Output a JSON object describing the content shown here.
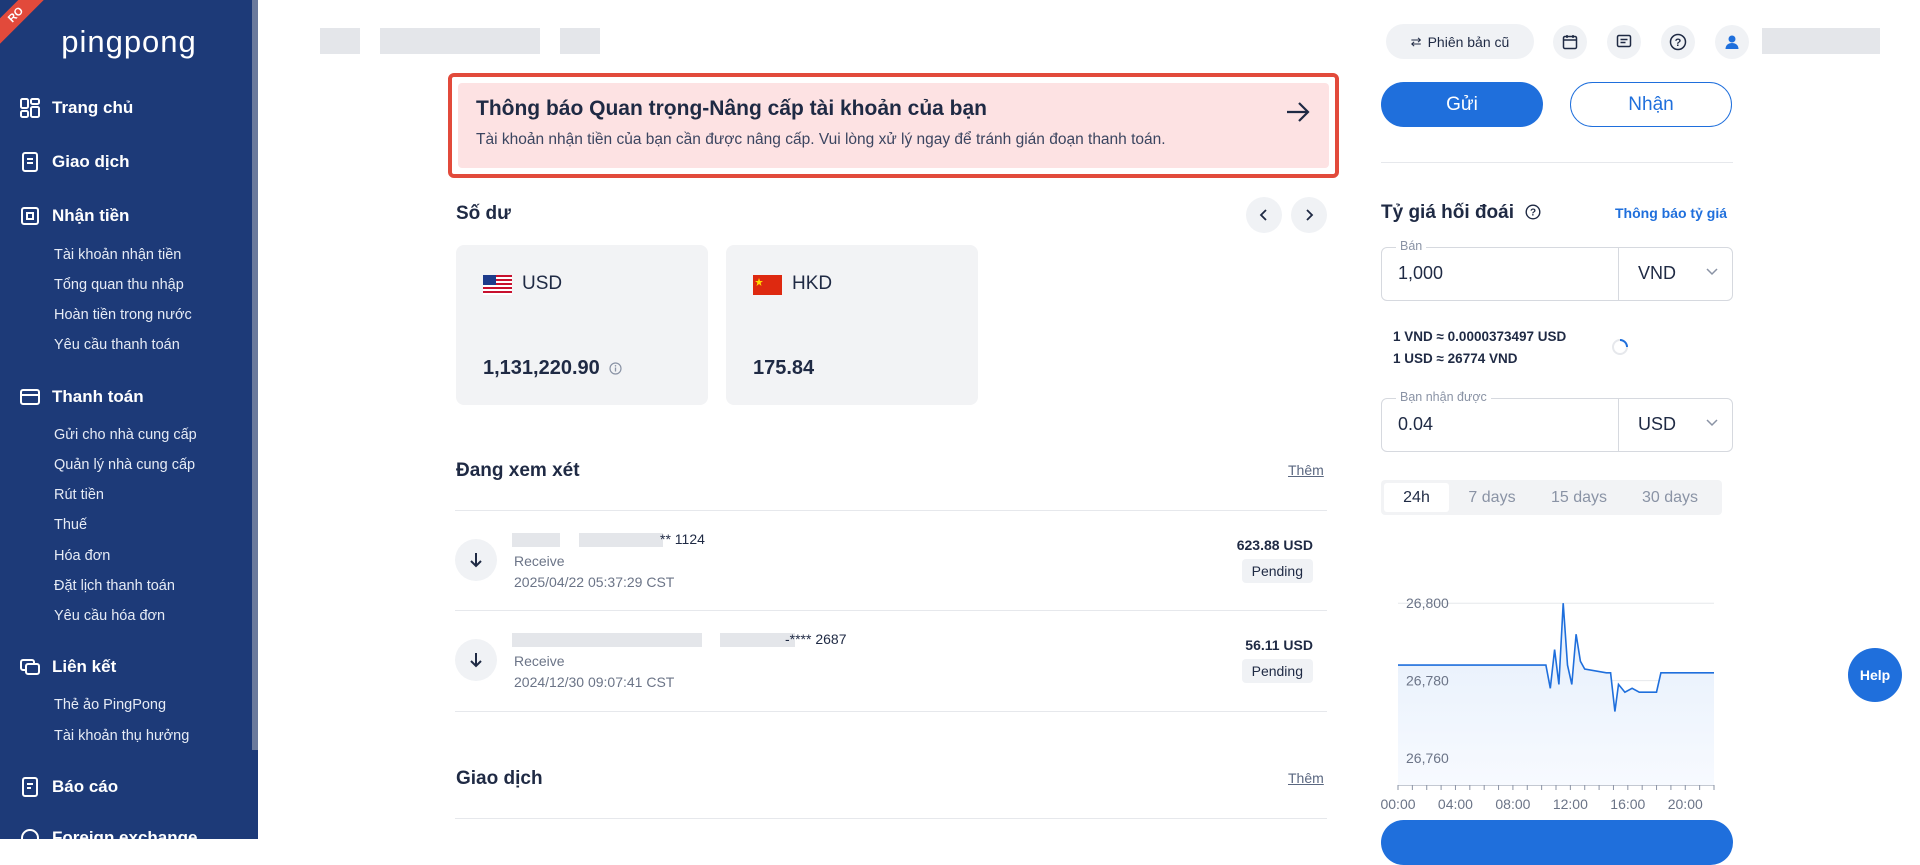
{
  "sidebar": {
    "ribbon": "RO",
    "logo": "pingpong",
    "items": [
      {
        "label": "Trang chủ",
        "icon": "dashboard-icon"
      },
      {
        "label": "Giao dịch",
        "icon": "document-icon"
      },
      {
        "label": "Nhận tiền",
        "icon": "receive-icon",
        "children": [
          "Tài khoản nhận tiền",
          "Tổng quan thu nhập",
          "Hoàn tiền trong nước",
          "Yêu cầu thanh toán"
        ]
      },
      {
        "label": "Thanh toán",
        "icon": "card-icon",
        "children": [
          "Gửi cho nhà cung cấp",
          "Quản lý nhà cung cấp",
          "Rút tiền",
          "Thuế",
          "Hóa đơn",
          "Đặt lịch thanh toán",
          "Yêu cầu hóa đơn"
        ]
      },
      {
        "label": "Liên kết",
        "icon": "link-cards-icon",
        "children": [
          "Thẻ ảo PingPong",
          "Tài khoản thụ hưởng"
        ]
      },
      {
        "label": "Báo cáo",
        "icon": "report-icon"
      },
      {
        "label": "Foreign exchange",
        "icon": "exchange-icon"
      }
    ]
  },
  "header": {
    "old_version": "Phiên bản cũ",
    "icons": [
      "calendar-icon",
      "message-icon",
      "help-circle-icon",
      "user-icon"
    ]
  },
  "alert": {
    "title": "Thông báo Quan trọng-Nâng cấp tài khoản của bạn",
    "body": "Tài khoản nhận tiền của bạn cần được nâng cấp. Vui lòng xử lý ngay để tránh gián đoạn thanh toán."
  },
  "balance": {
    "title": "Số dư",
    "cards": [
      {
        "currency": "USD",
        "amount": "1,131,220.90",
        "flag": "us-flag-icon"
      },
      {
        "currency": "HKD",
        "amount": "175.84",
        "flag": "cn-flag-icon"
      }
    ]
  },
  "review": {
    "title": "Đang xem xét",
    "more": "Thêm",
    "rows": [
      {
        "account": "** 1124",
        "type": "Receive",
        "date": "2025/04/22 05:37:29 CST",
        "amount": "623.88 USD",
        "status": "Pending"
      },
      {
        "account": "-**** 2687",
        "type": "Receive",
        "date": "2024/12/30 09:07:41 CST",
        "amount": "56.11 USD",
        "status": "Pending"
      }
    ]
  },
  "transactions": {
    "title": "Giao dịch",
    "more": "Thêm"
  },
  "actions": {
    "send": "Gửi",
    "receive": "Nhận"
  },
  "fx": {
    "title": "Tỷ giá hối đoái",
    "notify_link": "Thông báo tỷ giá",
    "sell_label": "Bán",
    "sell_value": "1,000",
    "sell_currency": "VND",
    "rate1": "1 VND ≈ 0.0000373497 USD",
    "rate2": "1 USD ≈ 26774 VND",
    "receive_label": "Bạn nhận được",
    "receive_value": "0.04",
    "receive_currency": "USD",
    "tabs": [
      "24h",
      "7 days",
      "15 days",
      "30 days"
    ],
    "active_tab": "24h"
  },
  "help_label": "Help",
  "chart_data": {
    "type": "line",
    "x_ticks": [
      "00:00",
      "04:00",
      "08:00",
      "12:00",
      "16:00",
      "20:00"
    ],
    "y_ticks": [
      "26,800",
      "26,780",
      "26,760"
    ],
    "ylim": [
      26753,
      26806
    ],
    "series": [
      {
        "values": [
          [
            0,
            26784
          ],
          [
            3,
            26784
          ],
          [
            6,
            26784
          ],
          [
            9,
            26784
          ],
          [
            10.3,
            26784
          ],
          [
            10.6,
            26778
          ],
          [
            10.9,
            26788
          ],
          [
            11.2,
            26779
          ],
          [
            11.5,
            26800
          ],
          [
            11.8,
            26784
          ],
          [
            12.1,
            26779
          ],
          [
            12.4,
            26792
          ],
          [
            12.7,
            26785
          ],
          [
            13,
            26783
          ],
          [
            14.5,
            26782
          ],
          [
            14.8,
            26782
          ],
          [
            15.1,
            26772
          ],
          [
            15.35,
            26779
          ],
          [
            15.8,
            26777
          ],
          [
            16.3,
            26778
          ],
          [
            16.8,
            26777
          ],
          [
            17.5,
            26777
          ],
          [
            18,
            26777
          ],
          [
            18.3,
            26782
          ],
          [
            21,
            26782
          ],
          [
            22,
            26782
          ]
        ]
      }
    ]
  }
}
